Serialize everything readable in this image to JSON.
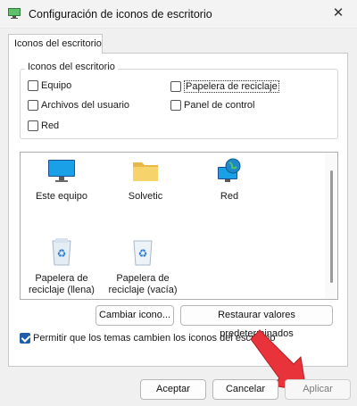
{
  "window": {
    "title": "Configuración de iconos de escritorio",
    "close_label": "✕"
  },
  "tab": {
    "label": "Iconos del escritorio"
  },
  "group": {
    "title": "Iconos del escritorio",
    "checkboxes": [
      {
        "label": "Equipo",
        "checked": false
      },
      {
        "label": "Papelera de reciclaje",
        "checked": false
      },
      {
        "label": "Archivos del usuario",
        "checked": false
      },
      {
        "label": "Panel de control",
        "checked": false
      },
      {
        "label": "Red",
        "checked": false
      }
    ]
  },
  "icons": [
    {
      "label": "Este equipo",
      "icon": "monitor-icon"
    },
    {
      "label": "Solvetic",
      "icon": "folder-icon"
    },
    {
      "label": "Red",
      "icon": "network-icon"
    },
    {
      "label": "Papelera de reciclaje (llena)",
      "icon": "recycle-bin-full-icon"
    },
    {
      "label": "Papelera de reciclaje (vacía)",
      "icon": "recycle-bin-empty-icon"
    }
  ],
  "buttons": {
    "change_icon": "Cambiar icono...",
    "restore_defaults": "Restaurar valores predeterminados",
    "ok": "Aceptar",
    "cancel": "Cancelar",
    "apply": "Aplicar"
  },
  "allow_themes": {
    "label": "Permitir que los temas cambien los iconos del escritorio",
    "checked": true
  },
  "colors": {
    "accent": "#1f5fa8",
    "arrow": "#e8333a"
  }
}
